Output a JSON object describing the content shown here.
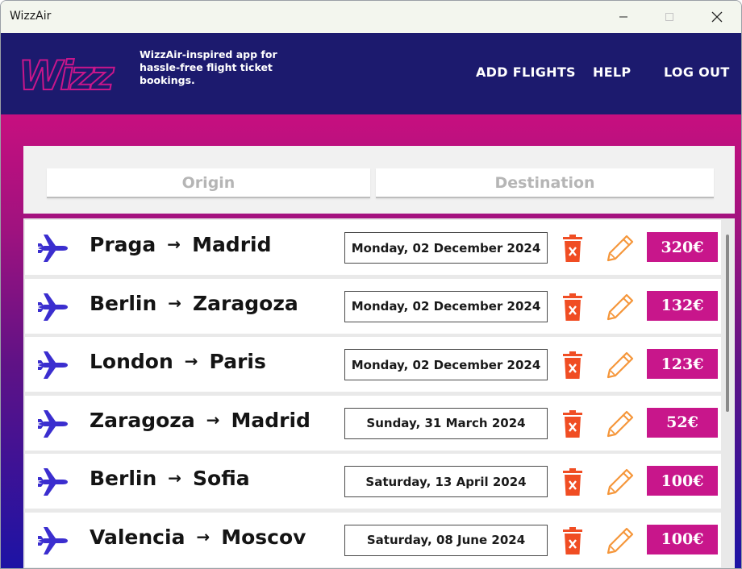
{
  "window": {
    "title": "WizzAir"
  },
  "header": {
    "logo_text": "Wizz",
    "tagline": "WizzAir-inspired app for hassle-free flight ticket bookings.",
    "nav": {
      "add_flights": "ADD FLIGHTS",
      "help": "HELP",
      "log_out": "LOG OUT"
    }
  },
  "search": {
    "origin_placeholder": "Origin",
    "destination_placeholder": "Destination"
  },
  "colors": {
    "header_bg": "#1c1a6e",
    "accent": "#c8168b",
    "price_bg": "#c8168b",
    "trash": "#f04d23",
    "edit": "#f5963a",
    "plane": "#3b2ecf"
  },
  "icons": {
    "flight": "airplane-icon",
    "delete": "trash-icon",
    "edit": "pencil-icon"
  },
  "flights": [
    {
      "origin": "Praga",
      "destination": "Madrid",
      "date": "Monday, 02 December 2024",
      "price": "320€"
    },
    {
      "origin": "Berlin",
      "destination": "Zaragoza",
      "date": "Monday, 02 December 2024",
      "price": "132€"
    },
    {
      "origin": "London",
      "destination": "Paris",
      "date": "Monday, 02 December 2024",
      "price": "123€"
    },
    {
      "origin": "Zaragoza",
      "destination": "Madrid",
      "date": "Sunday, 31 March 2024",
      "price": "52€"
    },
    {
      "origin": "Berlin",
      "destination": "Sofia",
      "date": "Saturday, 13 April 2024",
      "price": "100€"
    },
    {
      "origin": "Valencia",
      "destination": "Moscov",
      "date": "Saturday, 08 June 2024",
      "price": "100€"
    }
  ]
}
